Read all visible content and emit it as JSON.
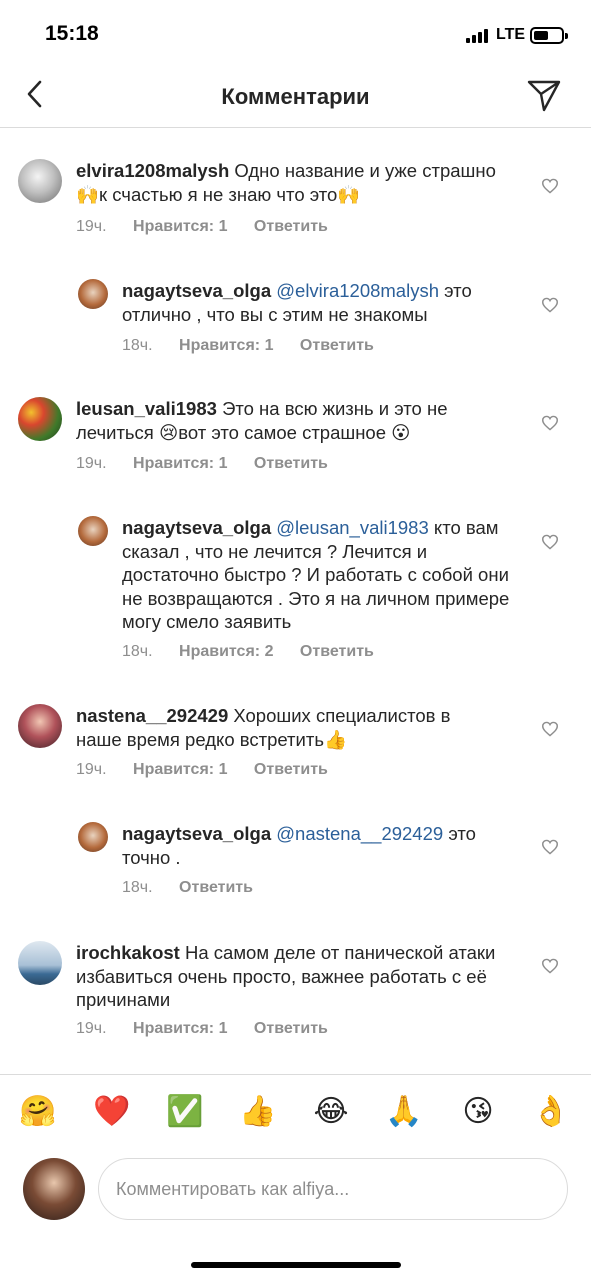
{
  "status_bar": {
    "time": "15:18",
    "network": "LTE"
  },
  "header": {
    "title": "Комментарии",
    "back_icon": "chevron-left-icon",
    "send_icon": "paper-plane-icon"
  },
  "comments": [
    {
      "username": "elvira1208malysh",
      "mention": "",
      "text": "Одно название и уже страшно 🙌к счастью я не знаю что это🙌",
      "time": "19ч.",
      "likes": "Нравится: 1",
      "reply": "Ответить"
    },
    {
      "username": "nagaytseva_olga",
      "mention": "@elvira1208malysh",
      "text": "это отлично , что вы с этим не знакомы",
      "time": "18ч.",
      "likes": "Нравится: 1",
      "reply": "Ответить"
    },
    {
      "username": "leusan_vali1983",
      "mention": "",
      "text": "Это на всю жизнь и это не лечиться 😢вот это самое страшное 😮",
      "time": "19ч.",
      "likes": "Нравится: 1",
      "reply": "Ответить"
    },
    {
      "username": "nagaytseva_olga",
      "mention": "@leusan_vali1983",
      "text": "кто вам сказал , что не лечится ? Лечится и достаточно быстро ? И работать с собой они не возвращаются . Это я на личном примере могу смело заявить",
      "time": "18ч.",
      "likes": "Нравится: 2",
      "reply": "Ответить"
    },
    {
      "username": "nastena__292429",
      "mention": "",
      "text": "Хороших специалистов в наше время редко встретить👍",
      "time": "19ч.",
      "likes": "Нравится: 1",
      "reply": "Ответить"
    },
    {
      "username": "nagaytseva_olga",
      "mention": "@nastena__292429",
      "text": "это точно .",
      "time": "18ч.",
      "likes": "",
      "reply": "Ответить"
    },
    {
      "username": "irochkakost",
      "mention": "",
      "text": "На самом деле от панической атаки избавиться очень просто, важнее работать с её причинами",
      "time": "19ч.",
      "likes": "Нравится: 1",
      "reply": "Ответить"
    }
  ],
  "emoji_bar": [
    "🤗",
    "❤️",
    "✅",
    "👍",
    "😂",
    "🙏",
    "😘",
    "👌"
  ],
  "composer": {
    "placeholder": "Комментировать как alfiya..."
  },
  "colors": {
    "mention": "#2b5f99",
    "secondary_text": "#8e8e8e",
    "divider": "#dbdbdb"
  }
}
